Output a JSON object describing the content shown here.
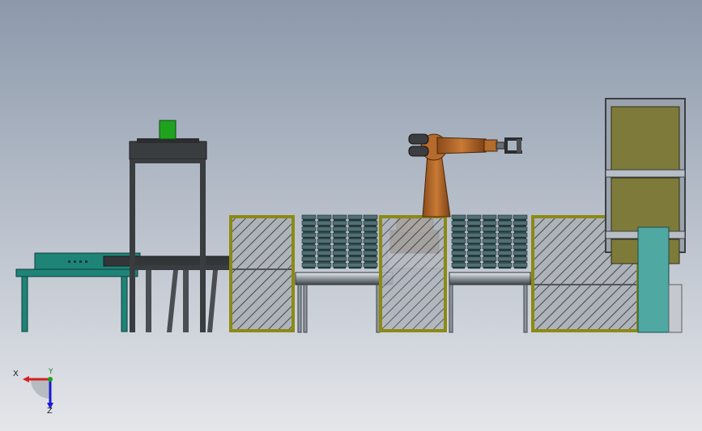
{
  "viewport": {
    "background_top": "#8c99ab",
    "background_bottom": "#e4e6ea"
  },
  "triad": {
    "x_label": "X",
    "y_label": "Y",
    "z_label": "Z",
    "x_color": "#d42020",
    "y_color": "#1aa11a",
    "z_color": "#1a1ad4"
  },
  "colors": {
    "conveyor_teal": "#1f8478",
    "frame_dark": "#3a3d40",
    "guard_olive": "#8c8a14",
    "robot_orange": "#b56b2c",
    "pallet_teal": "#4f7075",
    "cabinet_panel": "#7e7b3a",
    "green_part": "#1fa31f"
  }
}
